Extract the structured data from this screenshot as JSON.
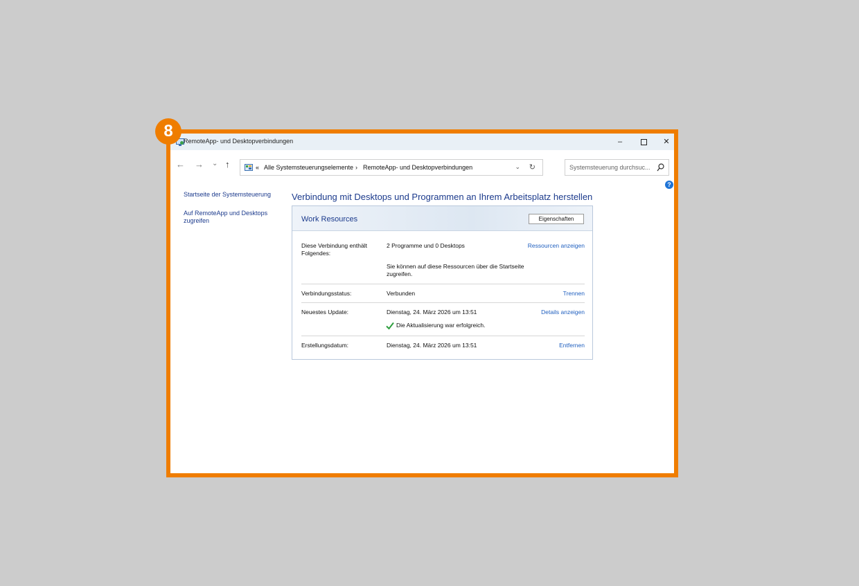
{
  "badge": "8",
  "window": {
    "title": "RemoteApp- und Desktopverbindungen",
    "controls": {
      "minimize": "–",
      "close": "✕"
    }
  },
  "nav": {
    "back": "←",
    "forward": "→",
    "recent": "⌄",
    "up": "↑",
    "address": {
      "chevrons": "«",
      "crumb1": "Alle Systemsteuerungselemente",
      "separator": "›",
      "crumb2": "RemoteApp- und Desktopverbindungen",
      "dropdown": "⌄",
      "refresh": "↻"
    },
    "search_placeholder": "Systemsteuerung durchsuc..."
  },
  "help": "?",
  "sidebar": {
    "items": [
      {
        "label": "Startseite der Systemsteuerung"
      },
      {
        "label": "Auf RemoteApp und Desktops zugreifen"
      }
    ]
  },
  "main": {
    "heading": "Verbindung mit Desktops und Programmen an Ihrem Arbeitsplatz herstellen",
    "panel": {
      "title": "Work Resources",
      "properties_button": "Eigenschaften",
      "rows": [
        {
          "label": "Diese Verbindung enthält Folgendes:",
          "value": "2 Programme und 0 Desktops",
          "note": "Sie können auf diese Ressourcen über die Startseite zugreifen.",
          "action": "Ressourcen anzeigen"
        },
        {
          "label": "Verbindungsstatus:",
          "value": "Verbunden",
          "action": "Trennen"
        },
        {
          "label": "Neuestes Update:",
          "value": "Dienstag, 24. März 2026 um 13:51",
          "note": "Die Aktualisierung war erfolgreich.",
          "action": "Details anzeigen"
        },
        {
          "label": "Erstellungsdatum:",
          "value": "Dienstag, 24. März 2026 um 13:51",
          "action": "Entfernen"
        }
      ]
    }
  },
  "colors": {
    "frame": "#ef7d00",
    "link": "#1f5fbf",
    "heading": "#1b3a8c",
    "success": "#2e9e3e"
  }
}
